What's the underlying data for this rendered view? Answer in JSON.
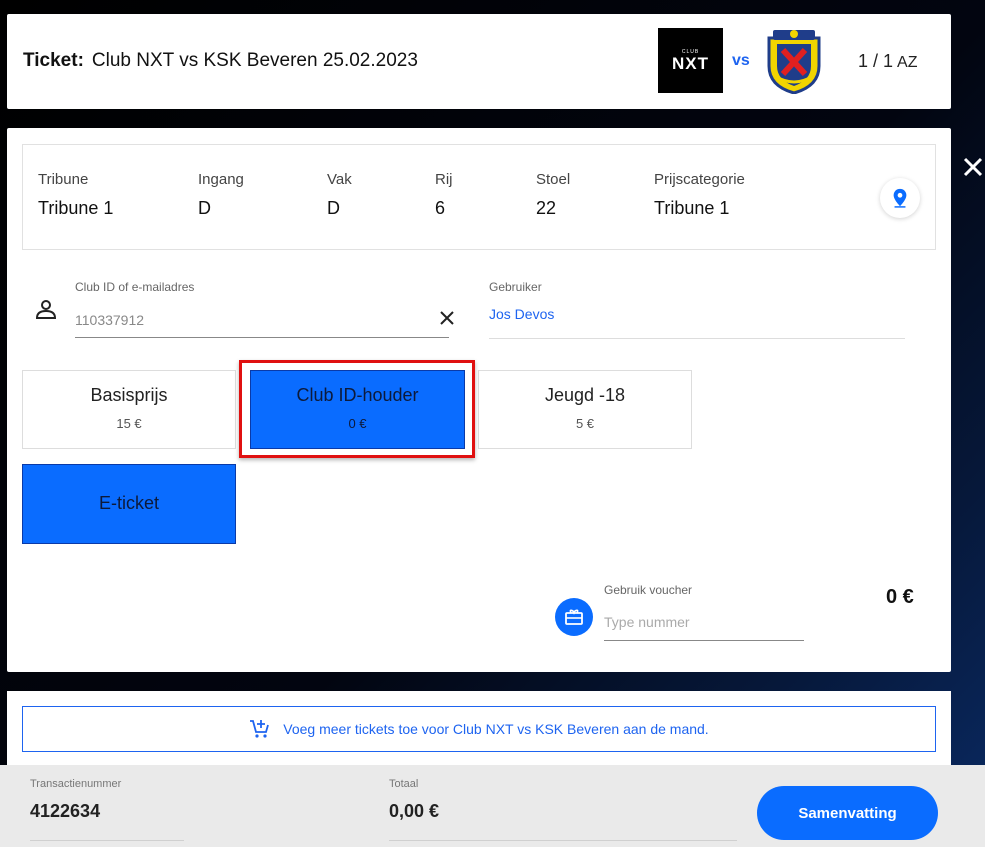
{
  "header": {
    "ticket_label": "Ticket:",
    "match_title": "Club NXT vs KSK Beveren 25.02.2023",
    "home_logo_small": "CLUB",
    "home_logo_text": "NXT",
    "vs": "vs",
    "pager": "1 / 1",
    "sort_icon_text": "AZ"
  },
  "seat": {
    "columns": [
      {
        "key": "Tribune",
        "value": "Tribune 1"
      },
      {
        "key": "Ingang",
        "value": "D"
      },
      {
        "key": "Vak",
        "value": "D"
      },
      {
        "key": "Rij",
        "value": "6"
      },
      {
        "key": "Stoel",
        "value": "22"
      },
      {
        "key": "Prijscategorie",
        "value": "Tribune 1"
      }
    ]
  },
  "user": {
    "clubid_label": "Club ID of e-mailadres",
    "clubid_value": "110337912",
    "user_label": "Gebruiker",
    "user_value": "Jos Devos"
  },
  "prices": [
    {
      "name": "Basisprijs",
      "amount": "15 €",
      "selected": false
    },
    {
      "name": "Club ID-houder",
      "amount": "0 €",
      "selected": true
    },
    {
      "name": "Jeugd -18",
      "amount": "5 €",
      "selected": false
    }
  ],
  "delivery": {
    "label": "E-ticket"
  },
  "voucher": {
    "label": "Gebruik voucher",
    "placeholder": "Type nummer",
    "total": "0 €"
  },
  "add_more": {
    "label": "Voeg meer tickets toe voor Club NXT vs KSK Beveren aan de mand."
  },
  "footer": {
    "transaction_label": "Transactienummer",
    "transaction_value": "4122634",
    "total_label": "Totaal",
    "total_value": "0,00 €",
    "summary_button": "Samenvatting"
  },
  "colors": {
    "accent": "#0a6cff",
    "link": "#1e64f0",
    "highlight": "#e01010"
  }
}
